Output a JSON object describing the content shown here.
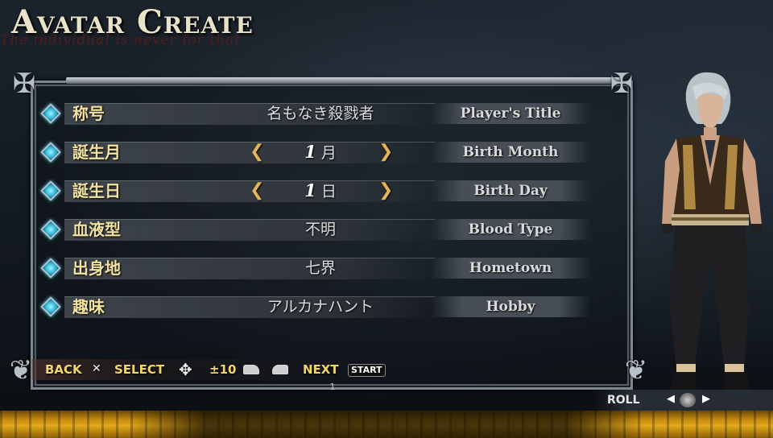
{
  "screen": {
    "title": "Avatar Create",
    "subtitle": "The individual is never for that"
  },
  "fields": [
    {
      "label": "称号",
      "value": "名もなき殺戮者",
      "english": "Player's Title",
      "has_arrows": false
    },
    {
      "label": "誕生月",
      "value_num": "1",
      "value_unit": "月",
      "english": "Birth Month",
      "has_arrows": true
    },
    {
      "label": "誕生日",
      "value_num": "1",
      "value_unit": "日",
      "english": "Birth Day",
      "has_arrows": true
    },
    {
      "label": "血液型",
      "value": "不明",
      "english": "Blood Type",
      "has_arrows": false
    },
    {
      "label": "出身地",
      "value": "七界",
      "english": "Hometown",
      "has_arrows": false
    },
    {
      "label": "趣味",
      "value": "アルカナハント",
      "english": "Hobby",
      "has_arrows": false
    }
  ],
  "controls": {
    "back_label": "BACK",
    "back_icon": "cross-button-icon",
    "select_label": "SELECT",
    "select_icon": "dpad-icon",
    "step_label": "±10",
    "step_icons": [
      "l-shoulder-icon",
      "r-shoulder-icon"
    ],
    "next_label": "NEXT",
    "start_label": "START"
  },
  "page_indicator": "1",
  "roll": {
    "label": "ROLL",
    "icon": "analog-stick-icon"
  },
  "colors": {
    "label": "#f2e2a0",
    "accent_diamond": "#2fb8d6",
    "arrow": "#e6b456",
    "control_text": "#f2d66a",
    "gold_strip": "#e3a81a"
  }
}
